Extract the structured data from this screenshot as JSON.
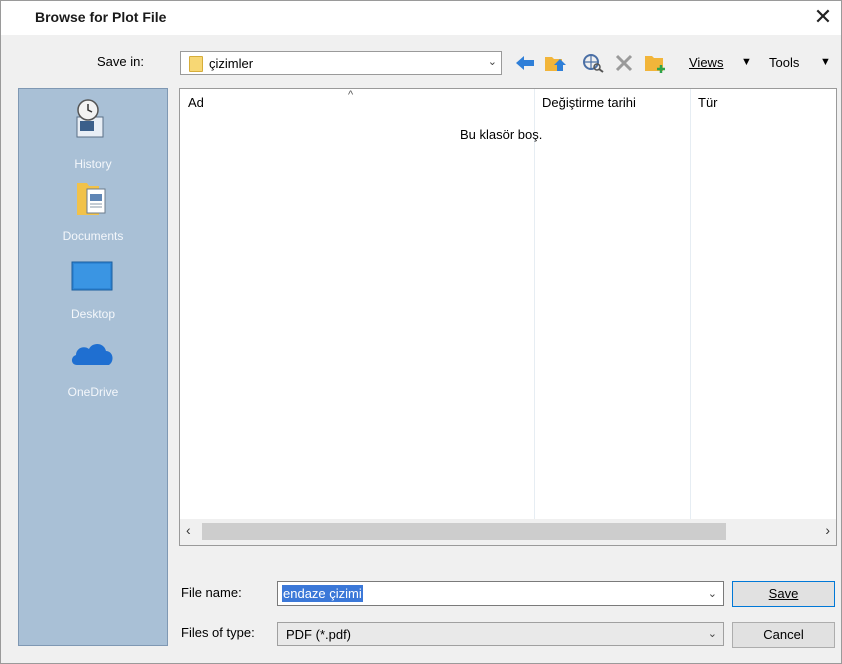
{
  "dialog": {
    "title": "Browse for Plot File",
    "close_glyph": "✕"
  },
  "toolbar": {
    "save_in_label": "Save in:",
    "folder_value": "çizimler",
    "views_label": "Views",
    "tools_label": "Tools",
    "dropdown_glyph": "▼",
    "icons": [
      "back-arrow-icon",
      "up-folder-icon",
      "search-web-icon",
      "delete-icon",
      "new-folder-icon"
    ]
  },
  "places": [
    {
      "label": "History",
      "icon": "history-icon"
    },
    {
      "label": "Documents",
      "icon": "documents-icon"
    },
    {
      "label": "Desktop",
      "icon": "desktop-icon"
    },
    {
      "label": "OneDrive",
      "icon": "onedrive-icon"
    }
  ],
  "filelist": {
    "columns": [
      "Ad",
      "Değiştirme tarihi",
      "Tür"
    ],
    "empty_message": "Bu klasör boş."
  },
  "form": {
    "filename_label": "File name:",
    "filename_value": "endaze çizimi",
    "filetype_label": "Files of type:",
    "filetype_value": "PDF (*.pdf)",
    "save_label": "Save",
    "cancel_label": "Cancel"
  },
  "colors": {
    "places_bg": "#a9c0d6",
    "selection": "#3b78d8",
    "arrow_blue": "#2f7fd8",
    "folder_yellow": "#f2b53a"
  }
}
